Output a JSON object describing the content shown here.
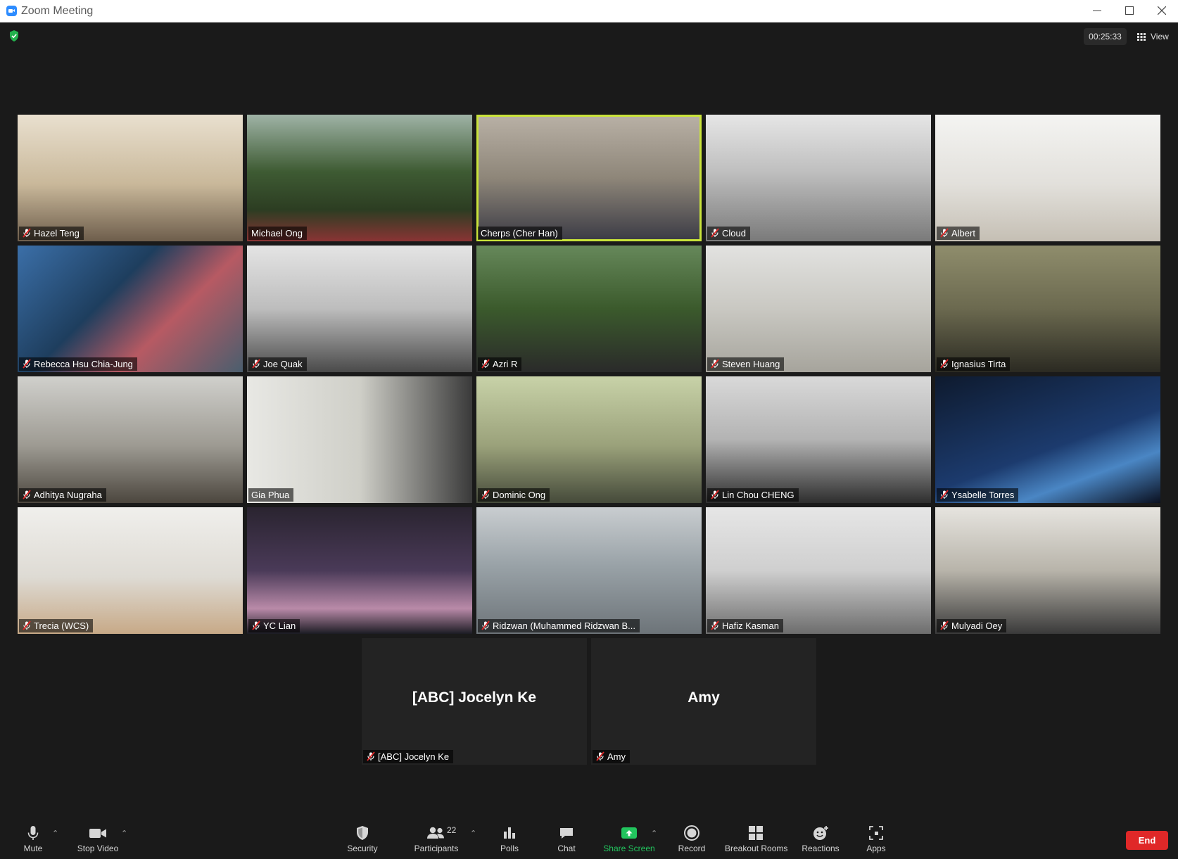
{
  "window": {
    "title": "Zoom Meeting"
  },
  "header": {
    "timer": "00:25:33",
    "view_label": "View"
  },
  "participants": [
    {
      "name": "Hazel Teng",
      "muted": true,
      "bg": "linear-gradient(180deg,#e9e0cf 0%,#c9b89a 55%,#6e5e4c 100%)"
    },
    {
      "name": "Michael Ong",
      "muted": false,
      "bg": "linear-gradient(180deg,#9fb3a6 0%,#3e5b33 45%,#2c3d22 75%,#8a3434 100%)"
    },
    {
      "name": "Cherps (Cher Han)",
      "muted": false,
      "active": true,
      "bg": "linear-gradient(180deg,#b9b1a6 0%,#8e8679 50%,#3a3a44 100%)"
    },
    {
      "name": "Cloud",
      "muted": true,
      "bg": "linear-gradient(180deg,#e6e6e6 0%,#bfbfbf 45%,#7a7a7a 100%)"
    },
    {
      "name": "Albert",
      "muted": true,
      "bg": "linear-gradient(180deg,#f4f4f2 0%,#e2e0db 55%,#c5bfb4 100%)"
    },
    {
      "name": "Rebecca Hsu Chia-Jung",
      "muted": true,
      "bg": "linear-gradient(135deg,#3b6fa8 0%,#1e3e5e 40%,#b75a63 65%,#4a5e6e 100%)"
    },
    {
      "name": "Joe Quak",
      "muted": true,
      "bg": "linear-gradient(180deg,#e4e4e4 0%,#bdbdbd 50%,#4a4a4a 100%)"
    },
    {
      "name": "Azri R",
      "muted": true,
      "bg": "linear-gradient(180deg,#66885a 0%,#3b5a2c 50%,#2a2a2a 100%)"
    },
    {
      "name": "Steven Huang",
      "muted": true,
      "bg": "linear-gradient(180deg,#e2e2e0 0%,#c9c8c2 50%,#a6a49c 100%)"
    },
    {
      "name": "Ignasius Tirta",
      "muted": true,
      "bg": "linear-gradient(180deg,#8f8d6c 0%,#6b694f 50%,#2b2a22 100%)"
    },
    {
      "name": "Adhitya Nugraha",
      "muted": true,
      "bg": "linear-gradient(180deg,#d0d0cc 0%,#9d9a92 55%,#4c463e 100%)"
    },
    {
      "name": "Gia Phua",
      "muted": false,
      "bg": "linear-gradient(90deg,#e8e8e4 0%,#cfcfc8 50%,#3a3a3a 100%)"
    },
    {
      "name": "Dominic Ong",
      "muted": true,
      "bg": "linear-gradient(180deg,#c8d2a8 0%,#9aa17a 55%,#454a3a 100%)"
    },
    {
      "name": "Lin Chou CHENG",
      "muted": true,
      "bg": "linear-gradient(180deg,#d9d9d9 0%,#b3b3b3 50%,#2e2e2e 100%)"
    },
    {
      "name": "Ysabelle Torres",
      "muted": true,
      "bg": "linear-gradient(160deg,#0e1a2e 0%,#1c3b6e 55%,#4a86c4 75%,#0a1020 100%)"
    },
    {
      "name": "Trecia (WCS)",
      "muted": true,
      "bg": "linear-gradient(180deg,#f0efec 0%,#dedbd4 55%,#c7a987 100%)"
    },
    {
      "name": "YC Lian",
      "muted": true,
      "bg": "linear-gradient(180deg,#2a2430 0%,#4a3a58 50%,#b98aa8 80%,#1c1c24 100%)"
    },
    {
      "name": "Ridzwan (Muhammed Ridzwan B...",
      "muted": true,
      "bg": "linear-gradient(180deg,#c9cdd0 0%,#9aa3a8 45%,#6d7479 100%)"
    },
    {
      "name": "Hafiz Kasman",
      "muted": true,
      "bg": "linear-gradient(180deg,#e6e6e6 0%,#cfcfcf 50%,#6d6d6d 100%)"
    },
    {
      "name": "Mulyadi Oey",
      "muted": true,
      "bg": "linear-gradient(180deg,#e6e4df 0%,#b8b4aa 50%,#3a3a3a 100%)"
    },
    {
      "name": "[ABC] Jocelyn Ke",
      "muted": true,
      "no_video": true,
      "display": "[ABC] Jocelyn Ke",
      "bg": "#232323"
    },
    {
      "name": "Amy",
      "muted": true,
      "no_video": true,
      "display": "Amy",
      "bg": "#232323"
    }
  ],
  "toolbar": {
    "mute": "Mute",
    "stop_video": "Stop Video",
    "security": "Security",
    "participants": "Participants",
    "participants_count": "22",
    "polls": "Polls",
    "chat": "Chat",
    "share_screen": "Share Screen",
    "record": "Record",
    "breakout_rooms": "Breakout Rooms",
    "reactions": "Reactions",
    "apps": "Apps",
    "end": "End"
  },
  "colors": {
    "share_green": "#22c55e",
    "end_red": "#e02828",
    "active_speaker": "#c9e33a"
  }
}
